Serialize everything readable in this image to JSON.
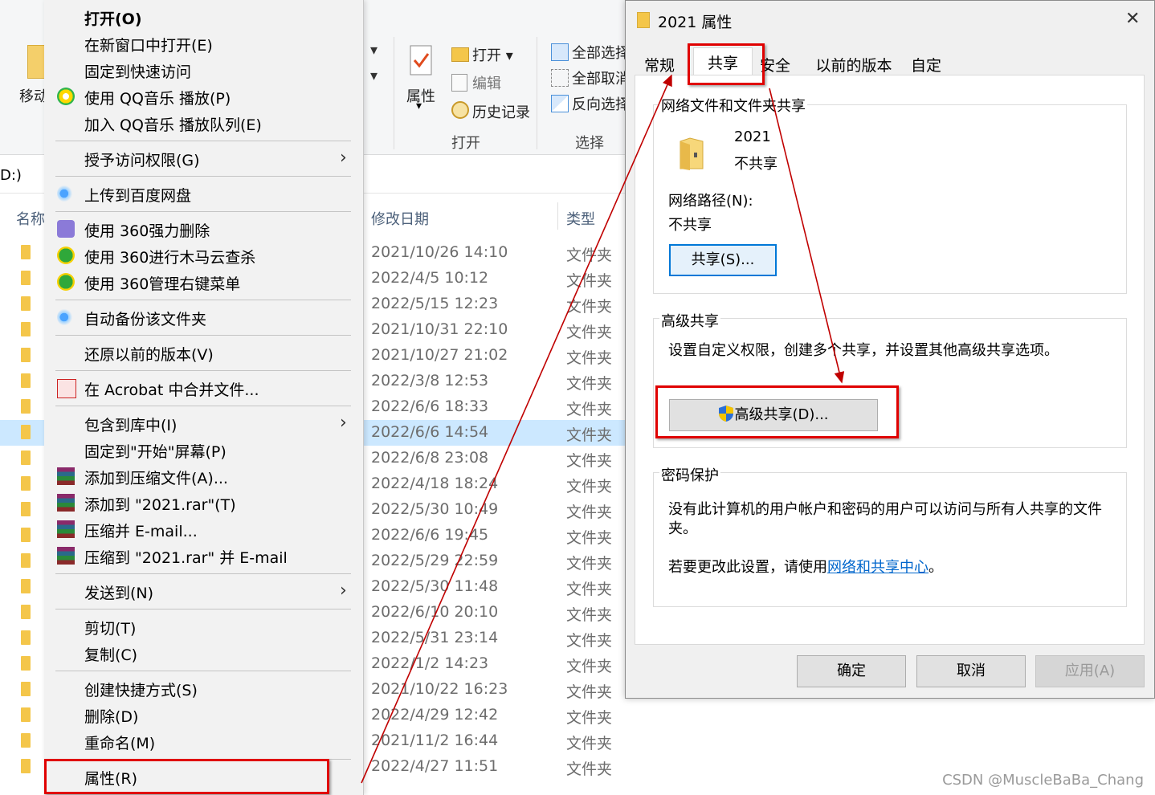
{
  "explorer": {
    "ribbon": {
      "move_label": "移动",
      "props_label": "属性",
      "open_label": "打开",
      "edit_label": "编辑",
      "history_label": "历史记录",
      "open_group": "打开",
      "select_all": "全部选择",
      "select_none": "全部取消",
      "invert": "反向选择",
      "select_group": "选择"
    },
    "address": "D:)",
    "columns": {
      "name": "名称",
      "date": "修改日期",
      "type": "类型"
    },
    "rows": [
      {
        "date": "2021/10/26 14:10",
        "type": "文件夹"
      },
      {
        "date": "2022/4/5 10:12",
        "type": "文件夹"
      },
      {
        "date": "2022/5/15 12:23",
        "type": "文件夹"
      },
      {
        "date": "2021/10/31 22:10",
        "type": "文件夹"
      },
      {
        "date": "2021/10/27 21:02",
        "type": "文件夹"
      },
      {
        "date": "2022/3/8 12:53",
        "type": "文件夹"
      },
      {
        "date": "2022/6/6 18:33",
        "type": "文件夹"
      },
      {
        "date": "2022/6/6 14:54",
        "type": "文件夹"
      },
      {
        "date": "2022/6/8 23:08",
        "type": "文件夹"
      },
      {
        "date": "2022/4/18 18:24",
        "type": "文件夹"
      },
      {
        "date": "2022/5/30 10:49",
        "type": "文件夹"
      },
      {
        "date": "2022/6/6 19:45",
        "type": "文件夹"
      },
      {
        "date": "2022/5/29 22:59",
        "type": "文件夹"
      },
      {
        "date": "2022/5/30 11:48",
        "type": "文件夹"
      },
      {
        "date": "2022/6/10 20:10",
        "type": "文件夹"
      },
      {
        "date": "2022/5/31 23:14",
        "type": "文件夹"
      },
      {
        "date": "2022/1/2 14:23",
        "type": "文件夹"
      },
      {
        "date": "2021/10/22 16:23",
        "type": "文件夹"
      },
      {
        "date": "2022/4/29 12:42",
        "type": "文件夹"
      },
      {
        "date": "2021/11/2 16:44",
        "type": "文件夹"
      },
      {
        "date": "2022/4/27 11:51",
        "type": "文件夹"
      }
    ]
  },
  "context_menu": {
    "items": [
      {
        "label": "打开(O)",
        "bold": true
      },
      {
        "label": "在新窗口中打开(E)"
      },
      {
        "label": "固定到快速访问"
      },
      {
        "label": "使用 QQ音乐 播放(P)",
        "icon": "qq-music-icon"
      },
      {
        "label": "加入 QQ音乐 播放队列(E)"
      },
      {
        "label": "授予访问权限(G)",
        "submenu": true
      },
      {
        "label": "上传到百度网盘",
        "icon": "baidu-netdisk-icon"
      },
      {
        "label": "使用 360强力删除",
        "icon": "360-delete-icon"
      },
      {
        "label": "使用 360进行木马云查杀",
        "icon": "360-scan-icon"
      },
      {
        "label": "使用 360管理右键菜单",
        "icon": "360-menu-icon"
      },
      {
        "label": "自动备份该文件夹",
        "icon": "baidu-backup-icon"
      },
      {
        "label": "还原以前的版本(V)"
      },
      {
        "label": "在 Acrobat 中合并文件...",
        "icon": "acrobat-icon"
      },
      {
        "label": "包含到库中(I)",
        "submenu": true
      },
      {
        "label": "固定到\"开始\"屏幕(P)"
      },
      {
        "label": "添加到压缩文件(A)...",
        "icon": "winrar-icon"
      },
      {
        "label": "添加到 \"2021.rar\"(T)",
        "icon": "winrar-icon"
      },
      {
        "label": "压缩并 E-mail...",
        "icon": "winrar-icon"
      },
      {
        "label": "压缩到 \"2021.rar\" 并 E-mail",
        "icon": "winrar-icon"
      },
      {
        "label": "发送到(N)",
        "submenu": true
      },
      {
        "label": "剪切(T)"
      },
      {
        "label": "复制(C)"
      },
      {
        "label": "创建快捷方式(S)"
      },
      {
        "label": "删除(D)"
      },
      {
        "label": "重命名(M)"
      },
      {
        "label": "属性(R)",
        "highlighted": true
      }
    ]
  },
  "dialog": {
    "title": "2021 属性",
    "close_glyph": "✕",
    "tabs": [
      "常规",
      "共享",
      "安全",
      "以前的版本",
      "自定义"
    ],
    "active_tab": "共享",
    "network_share": {
      "group_title": "网络文件和文件夹共享",
      "folder_name": "2021",
      "folder_status": "不共享",
      "path_label": "网络路径(N):",
      "path_value": "不共享",
      "share_button": "共享(S)..."
    },
    "advanced": {
      "group_title": "高级共享",
      "description": "设置自定义权限，创建多个共享，并设置其他高级共享选项。",
      "button": "高级共享(D)..."
    },
    "password": {
      "group_title": "密码保护",
      "line1": "没有此计算机的用户帐户和密码的用户可以访问与所有人共享的文件",
      "line2": "夹。",
      "change_prefix": "若要更改此设置，请使用",
      "link": "网络和共享中心",
      "change_suffix": "。"
    },
    "buttons": {
      "ok": "确定",
      "cancel": "取消",
      "apply": "应用(A)"
    }
  },
  "watermark": "CSDN @MuscleBaBa_Chang",
  "colors": {
    "highlight_red": "#e00000",
    "selection": "#cce8ff",
    "link": "#0066cc"
  }
}
